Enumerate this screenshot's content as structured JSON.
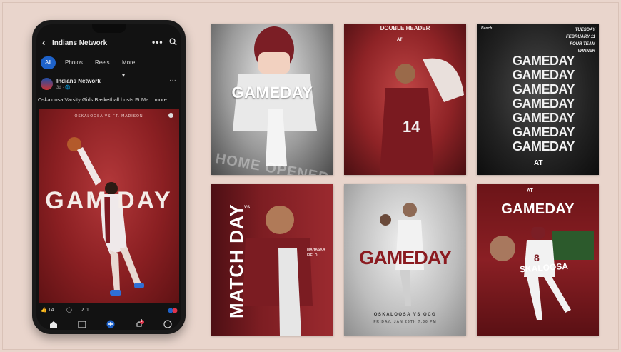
{
  "phone": {
    "header": {
      "title": "Indians Network"
    },
    "tabs": [
      {
        "label": "All"
      },
      {
        "label": "Photos"
      },
      {
        "label": "Reels"
      },
      {
        "label": "More"
      }
    ],
    "post": {
      "author": "Indians Network",
      "meta": "3d · 🌐",
      "caption": "Oskaloosa Varsity Girls Basketball hosts Ft Ma... more",
      "image_subtitle": "OSKALOOSA VS FT. MADISON",
      "image_title": "GAM DAY",
      "likes": "14",
      "shares": "1"
    },
    "icons": [
      "back-arrow-icon",
      "more-dots-icon",
      "search-icon",
      "like-icon",
      "comment-icon",
      "share-icon",
      "home-icon",
      "marketplace-icon",
      "feed-icon",
      "notifications-icon",
      "menu-icon"
    ],
    "notification_badge": "1"
  },
  "posters": {
    "p1": {
      "title": "GAMEDAY",
      "bottom": "HOME OPENER"
    },
    "p2": {
      "header": "DOUBLE HEADER",
      "at": "AT",
      "jersey": "14"
    },
    "p3": {
      "corner": "Bench",
      "script_lines": [
        "TUESDAY",
        "FEBRUARY 11",
        "FOUR TEAM WINNER"
      ],
      "stack": [
        "GAMEDAY",
        "GAMEDAY",
        "GAMEDAY",
        "GAMEDAY",
        "GAMEDAY",
        "GAMEDAY",
        "GAMEDAY"
      ],
      "at": "AT"
    },
    "p4": {
      "vertical_title": "MATCH DAY",
      "vs": "VS",
      "side_text": "MAHASKA FIELD"
    },
    "p5": {
      "title": "GAMEDAY",
      "sub": "OSKALOOSA VS OCG",
      "date": "FRIDAY, JAN 26TH 7:00 PM"
    },
    "p6": {
      "at": "AT",
      "title": "GAMEDAY",
      "school": "SKALOOSA",
      "jersey": "8"
    }
  },
  "colors": {
    "background": "#e9d5cc",
    "crimson": "#8b1b20",
    "fb_blue": "#1e62c9"
  }
}
